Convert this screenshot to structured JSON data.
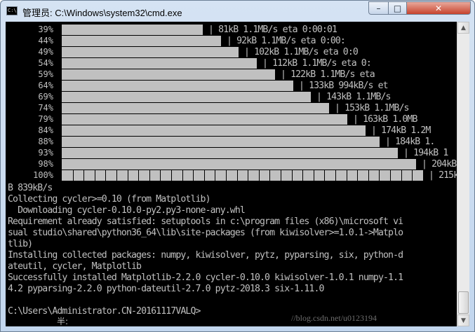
{
  "window": {
    "title": "管理员: C:\\Windows\\system32\\cmd.exe",
    "icon": "cmd-icon",
    "icon_text": "C:\\",
    "buttons": {
      "minimize": "–",
      "maximize": "□",
      "close": "✕"
    }
  },
  "progress_rows": [
    {
      "pct": "39%",
      "fraction": 0.39,
      "stats": "| 81kB 1.1MB/s eta 0:00:01"
    },
    {
      "pct": "44%",
      "fraction": 0.44,
      "stats": "| 92kB 1.1MB/s eta 0:00:"
    },
    {
      "pct": "49%",
      "fraction": 0.49,
      "stats": "| 102kB 1.1MB/s eta 0:0"
    },
    {
      "pct": "54%",
      "fraction": 0.54,
      "stats": "| 112kB 1.1MB/s eta 0:"
    },
    {
      "pct": "59%",
      "fraction": 0.59,
      "stats": "| 122kB 1.1MB/s eta"
    },
    {
      "pct": "64%",
      "fraction": 0.64,
      "stats": "| 133kB 994kB/s et"
    },
    {
      "pct": "69%",
      "fraction": 0.69,
      "stats": "| 143kB 1.1MB/s"
    },
    {
      "pct": "74%",
      "fraction": 0.74,
      "stats": "| 153kB 1.1MB/s"
    },
    {
      "pct": "79%",
      "fraction": 0.79,
      "stats": "| 163kB 1.0MB"
    },
    {
      "pct": "84%",
      "fraction": 0.84,
      "stats": "| 174kB 1.2M"
    },
    {
      "pct": "88%",
      "fraction": 0.88,
      "stats": "| 184kB 1."
    },
    {
      "pct": "93%",
      "fraction": 0.93,
      "stats": "| 194kB 1"
    },
    {
      "pct": "98%",
      "fraction": 0.98,
      "stats": "| 204kB"
    },
    {
      "pct": "100%",
      "fraction": 1.0,
      "stats": "| 215k"
    }
  ],
  "console_lines": [
    "B 839kB/s",
    "Collecting cycler>=0.10 (from Matplotlib)",
    "  Downloading cycler-0.10.0-py2.py3-none-any.whl",
    "Requirement already satisfied: setuptools in c:\\program files (x86)\\microsoft vi",
    "sual studio\\shared\\python36_64\\lib\\site-packages (from kiwisolver>=1.0.1->Matplo",
    "tlib)",
    "Installing collected packages: numpy, kiwisolver, pytz, pyparsing, six, python-d",
    "ateutil, cycler, Matplotlib",
    "Successfully installed Matplotlib-2.2.0 cycler-0.10.0 kiwisolver-1.0.1 numpy-1.1",
    "4.2 pyparsing-2.2.0 python-dateutil-2.7.0 pytz-2018.3 six-1.11.0",
    "",
    "C:\\Users\\Administrator.CN-20161117VALQ>"
  ],
  "ime_status": "半:",
  "watermark": "//blog.csdn.net/u0123194",
  "colors": {
    "console_bg": "#000000",
    "console_fg": "#c0c0c0"
  }
}
